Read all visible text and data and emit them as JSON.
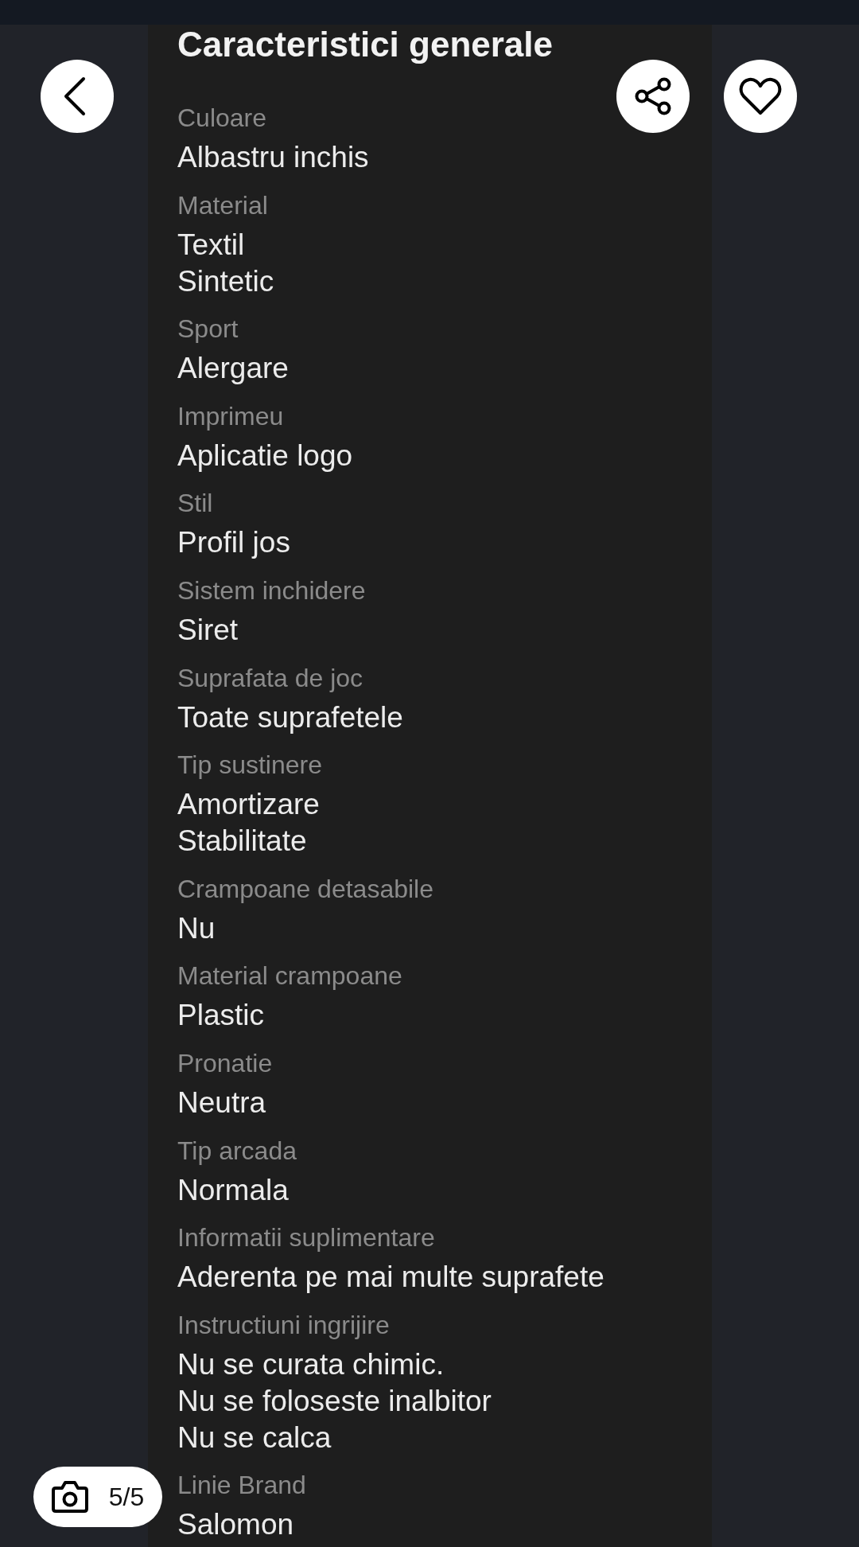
{
  "toolbar": {
    "favorited": false
  },
  "panel": {
    "title": "Caracteristici generale",
    "specs": [
      {
        "label": "Culoare",
        "values": [
          "Albastru inchis"
        ]
      },
      {
        "label": "Material",
        "values": [
          "Textil",
          "Sintetic"
        ]
      },
      {
        "label": "Sport",
        "values": [
          "Alergare"
        ]
      },
      {
        "label": "Imprimeu",
        "values": [
          "Aplicatie logo"
        ]
      },
      {
        "label": "Stil",
        "values": [
          "Profil jos"
        ]
      },
      {
        "label": "Sistem inchidere",
        "values": [
          "Siret"
        ]
      },
      {
        "label": "Suprafata de joc",
        "values": [
          "Toate suprafetele"
        ]
      },
      {
        "label": "Tip sustinere",
        "values": [
          "Amortizare",
          "Stabilitate"
        ]
      },
      {
        "label": "Crampoane detasabile",
        "values": [
          "Nu"
        ]
      },
      {
        "label": "Material crampoane",
        "values": [
          "Plastic"
        ]
      },
      {
        "label": "Pronatie",
        "values": [
          "Neutra"
        ]
      },
      {
        "label": "Tip arcada",
        "values": [
          "Normala"
        ]
      },
      {
        "label": "Informatii suplimentare",
        "values": [
          "Aderenta pe mai multe suprafete"
        ]
      },
      {
        "label": "Instructiuni ingrijire",
        "values": [
          "Nu se curata chimic.",
          "Nu se foloseste inalbitor",
          "Nu se calca"
        ]
      },
      {
        "label": "Linie Brand",
        "values": [
          "Salomon"
        ]
      }
    ]
  },
  "gallery": {
    "counter": "5/5"
  }
}
